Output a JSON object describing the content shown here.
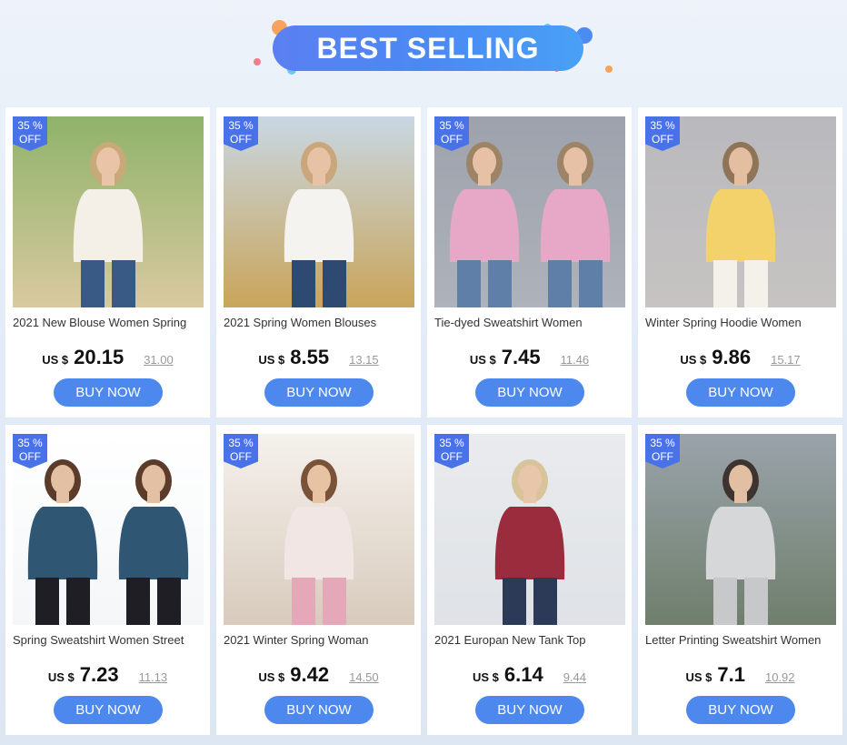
{
  "banner": {
    "title": "BEST SELLING"
  },
  "colors": {
    "accent": "#4d88ee",
    "badge": "#4a72e8"
  },
  "products": [
    {
      "badge_pct": "35 %",
      "badge_off": "OFF",
      "title": "2021 New Blouse Women Spring",
      "currency": "US $",
      "price": "20.15",
      "old_price": "31.00",
      "button": "BUY NOW"
    },
    {
      "badge_pct": "35 %",
      "badge_off": "OFF",
      "title": "2021 Spring Women Blouses",
      "currency": "US $",
      "price": "8.55",
      "old_price": "13.15",
      "button": "BUY NOW"
    },
    {
      "badge_pct": "35 %",
      "badge_off": "OFF",
      "title": "Tie-dyed Sweatshirt Women",
      "currency": "US $",
      "price": "7.45",
      "old_price": "11.46",
      "button": "BUY NOW"
    },
    {
      "badge_pct": "35 %",
      "badge_off": "OFF",
      "title": "Winter Spring Hoodie Women",
      "currency": "US $",
      "price": "9.86",
      "old_price": "15.17",
      "button": "BUY NOW"
    },
    {
      "badge_pct": "35 %",
      "badge_off": "OFF",
      "title": "Spring Sweatshirt Women Street",
      "currency": "US $",
      "price": "7.23",
      "old_price": "11.13",
      "button": "BUY NOW"
    },
    {
      "badge_pct": "35 %",
      "badge_off": "OFF",
      "title": "2021 Winter Spring Woman",
      "currency": "US $",
      "price": "9.42",
      "old_price": "14.50",
      "button": "BUY NOW"
    },
    {
      "badge_pct": "35 %",
      "badge_off": "OFF",
      "title": "2021 Europan New Tank Top",
      "currency": "US $",
      "price": "6.14",
      "old_price": "9.44",
      "button": "BUY NOW"
    },
    {
      "badge_pct": "35 %",
      "badge_off": "OFF",
      "title": "Letter Printing Sweatshirt Women",
      "currency": "US $",
      "price": "7.1",
      "old_price": "10.92",
      "button": "BUY NOW"
    }
  ]
}
